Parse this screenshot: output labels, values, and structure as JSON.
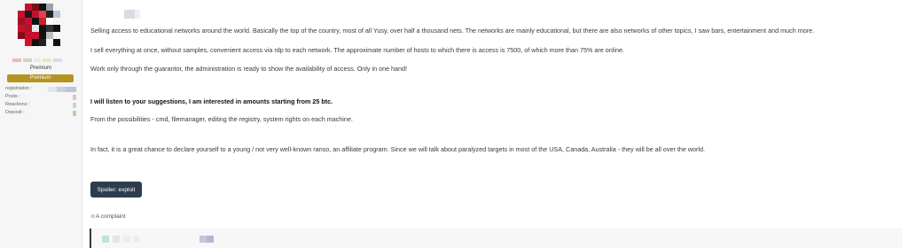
{
  "user_panel": {
    "rank_text": "Premium",
    "badge_label": "Premium",
    "stats": [
      {
        "label": "registration :"
      },
      {
        "label": "Posts :"
      },
      {
        "label": "Reactions :"
      },
      {
        "label": "Deposit :"
      }
    ]
  },
  "post": {
    "paragraphs": [
      "Selling access to educational networks around the world. Basically the top of the country, most of all Yusy, over half a thousand nets. The networks are mainly educational, but there are also networks of other topics, I saw bars, entertainment and much more.",
      "I sell everything at once, without samples, convenient access via rdp to each network. The approximate number of hosts to which there is access is 7500, of which more than 75% are online.",
      "Work only through the guarantor, the administration is ready to show the availability of access. Only in one hand!",
      "I will listen to your suggestions, I am interested in amounts starting from 25 btc.",
      "From the possibilities - cmd, filemanager, editing the registry, system rights on each machine.",
      "In fact, it is a great chance to declare yourself to a young / not very well-known ranso, an affiliate program. Since we will talk about paralyzed targets in most of the USA, Canada, Australia - they will be all over the world."
    ],
    "spoiler_label": "Spoiler: exploit",
    "complaint_label": "A complaint"
  },
  "colors": {
    "badge": "#b59421",
    "spoiler_bg": "#2e3d4e",
    "avatar_red": "#c8102e",
    "avatar_black": "#111111"
  }
}
